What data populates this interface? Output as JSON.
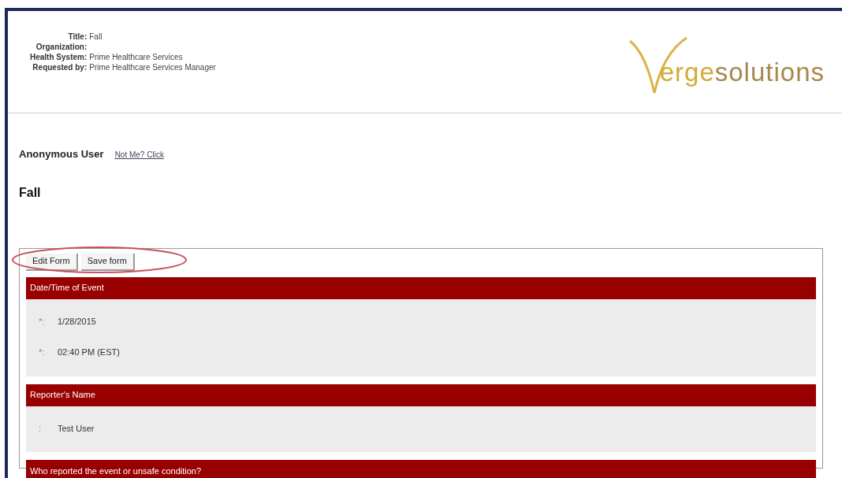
{
  "header": {
    "fields": [
      {
        "label": "Title:",
        "value": "Fall"
      },
      {
        "label": "Organization:"
      },
      {
        "label": "Health System:",
        "value": "Prime Healthcare Services"
      },
      {
        "label": "Requested by:",
        "value": "Prime Healthcare Services Manager"
      }
    ],
    "logo": {
      "lead": "erge",
      "rest": "solutions"
    }
  },
  "user": {
    "name": "Anonymous User",
    "link": "Not Me? Click"
  },
  "heading": "Fall",
  "buttons": [
    "Edit Form",
    "Save form"
  ],
  "sections": [
    {
      "title": "Date/Time of Event",
      "fields": [
        {
          "marker": "*:",
          "value": "1/28/2015"
        },
        {
          "marker": "*:",
          "value": "02:40 PM (EST)"
        }
      ]
    },
    {
      "title": "Reporter's Name",
      "fields": [
        {
          "marker": ":",
          "value": "Test User"
        }
      ]
    },
    {
      "title": "Who reported the event or unsafe condition?"
    }
  ]
}
